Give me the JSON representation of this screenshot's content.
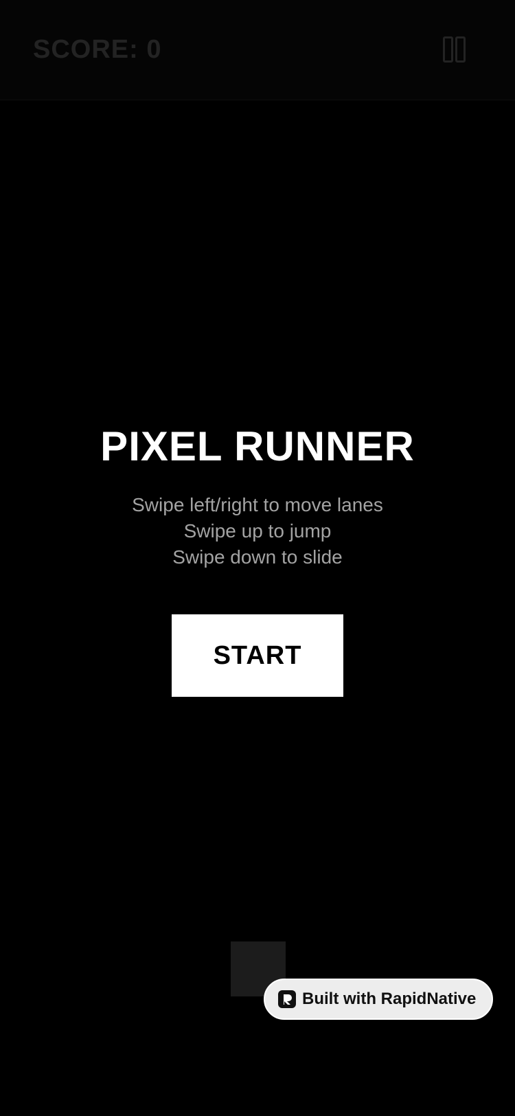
{
  "hud": {
    "score_text": "SCORE: 0",
    "pause_icon": "pause-icon"
  },
  "menu": {
    "title": "PIXEL RUNNER",
    "instructions": [
      "Swipe left/right to move lanes",
      "Swipe up to jump",
      "Swipe down to slide"
    ],
    "start_label": "START"
  },
  "badge": {
    "icon": "rapidnative-logo-icon",
    "text": "Built with RapidNative"
  },
  "colors": {
    "background": "#000000",
    "hud_text": "#232323",
    "title": "#ffffff",
    "instructions": "#a3a3a3",
    "start_button_bg": "#ffffff",
    "start_button_text": "#000000",
    "player": "#1c1c1c",
    "badge_bg": "#ededed"
  }
}
